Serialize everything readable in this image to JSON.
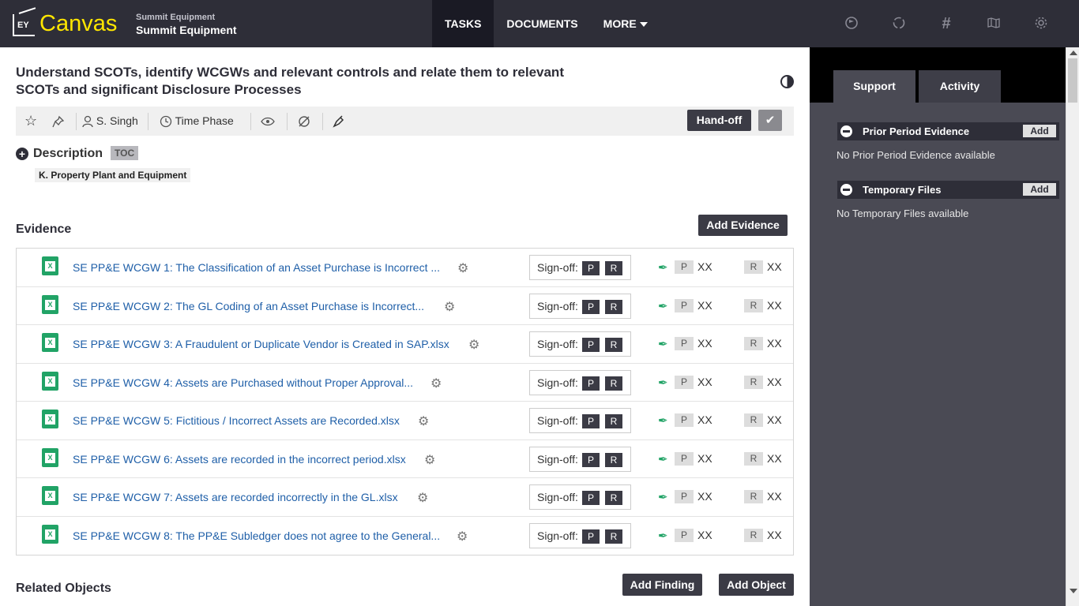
{
  "app": {
    "logo_text": "EY",
    "product": "Canvas",
    "client_small": "Summit Equipment",
    "client_big": "Summit Equipment"
  },
  "nav": {
    "tasks": "TASKS",
    "documents": "DOCUMENTS",
    "more": "MORE"
  },
  "task": {
    "title": "Understand SCOTs, identify WCGWs and relevant controls and relate them to relevant SCOTs and significant Disclosure Processes"
  },
  "toolbar": {
    "assignee": "S. Singh",
    "time_phase": "Time Phase",
    "handoff": "Hand-off"
  },
  "description": {
    "label": "Description",
    "toc": "TOC",
    "tag": "K. Property Plant and Equipment"
  },
  "evidence": {
    "title": "Evidence",
    "add_button": "Add Evidence",
    "signoff_label": "Sign-off:",
    "p": "P",
    "r": "R",
    "xx": "XX",
    "rows": [
      {
        "name": "SE PP&E WCGW 1: The Classification of an Asset Purchase is Incorrect ..."
      },
      {
        "name": "SE PP&E WCGW 2: The GL Coding of an Asset Purchase is Incorrect..."
      },
      {
        "name": "SE PP&E WCGW 3: A Fraudulent or Duplicate Vendor is Created in SAP.xlsx"
      },
      {
        "name": "SE PP&E WCGW 4: Assets are Purchased without Proper Approval..."
      },
      {
        "name": "SE PP&E WCGW 5: Fictitious / Incorrect Assets are Recorded.xlsx"
      },
      {
        "name": "SE PP&E WCGW 6: Assets are recorded in the incorrect period.xlsx"
      },
      {
        "name": "SE PP&E WCGW 7: Assets are recorded incorrectly in the GL.xlsx"
      },
      {
        "name": "SE PP&E WCGW 8: The PP&E Subledger does not agree to the General..."
      }
    ]
  },
  "related": {
    "title": "Related Objects",
    "add_finding": "Add Finding",
    "add_object": "Add Object"
  },
  "right_panel": {
    "tabs": [
      "Support",
      "Activity"
    ],
    "sections": [
      {
        "title": "Prior Period Evidence",
        "add": "Add",
        "empty": "No Prior Period Evidence available"
      },
      {
        "title": "Temporary Files",
        "add": "Add",
        "empty": "No Temporary Files available"
      }
    ]
  }
}
